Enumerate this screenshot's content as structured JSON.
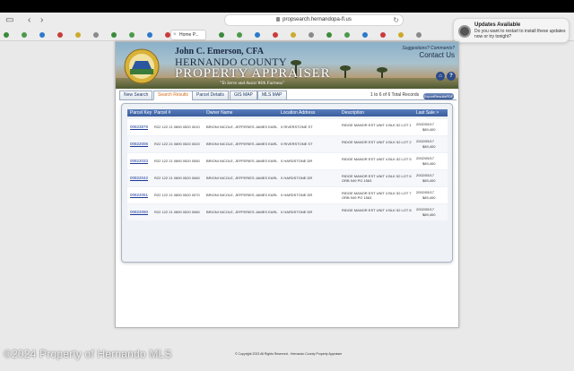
{
  "browser": {
    "url": "propsearch.hernandopa-fl.us",
    "active_tab": "Home P...",
    "favicon_colors": [
      "#3a8a3a",
      "#4a9a4a",
      "#2a7acc",
      "#cc3a3a",
      "#ccaa2a",
      "#8a8a8a"
    ]
  },
  "notification": {
    "title": "Updates Available",
    "body": "Do you want to restart to install these updates now or try tonight?"
  },
  "header": {
    "name": "John C. Emerson, CFA",
    "county": "HERNANDO COUNTY",
    "office": "PROPERTY APPRAISER",
    "motto": "\"To Serve and Assist With Fairness\"",
    "suggestions": "Suggestions? Comments?",
    "contact": "Contact Us"
  },
  "nav": {
    "tabs": [
      "New Search",
      "Search Results",
      "Parcel Details",
      "GIS MAP",
      "MLS MAP"
    ],
    "active_tab": "Search Results",
    "record_count": "1 to 6 of 6 Total Records",
    "export": "ExportResultsPDF"
  },
  "table": {
    "headers": [
      "Parcel Key",
      "Parcel #",
      "Owner Name",
      "Location Address",
      "Description",
      "Last Sale > $100"
    ],
    "rows": [
      {
        "key": "00823879",
        "parcel": "R22 122 21 0890 0520 0010",
        "owner": "BRIONI NICOLE, JEFFERIES JAMES EARL",
        "address": "0 RIVERSTONE ST",
        "description": "RIDGE MANOR EST UNIT 4 BLK 52 LOT 1",
        "sale_date": "2002/05/17",
        "sale_price": "$89,400"
      },
      {
        "key": "00822006",
        "parcel": "R22 122 21 0890 0520 0020",
        "owner": "BRIONI NICOLE, JEFFERIES JAMES EARL",
        "address": "0 RIVERSTONE ST",
        "description": "RIDGE MANOR EST UNIT 4 BLK 52 LOT 2",
        "sale_date": "2002/05/17",
        "sale_price": "$89,400"
      },
      {
        "key": "00822033",
        "parcel": "R22 122 21 0890 0520 0050",
        "owner": "BRIONI NICOLE, JEFFERIES JAMES EARL",
        "address": "0 HARDSTONE DR",
        "description": "RIDGE MANOR EST UNIT 4 BLK 52 LOT 5",
        "sale_date": "2002/05/17",
        "sale_price": "$89,400"
      },
      {
        "key": "00822042",
        "parcel": "R22 122 21 0890 0520 0060",
        "owner": "BRIONI NICOLE, JEFFERIES JAMES EARL",
        "address": "0 HARDSTONE DR",
        "description": "RIDGE MANOR EST UNIT 4 BLK 52 LOT 6 ORB 949 PG 1563",
        "sale_date": "2002/05/17",
        "sale_price": "$89,400"
      },
      {
        "key": "00822051",
        "parcel": "R22 122 21 0890 0520 0070",
        "owner": "BRIONI NICOLE, JEFFERIES JAMES EARL",
        "address": "0 HARDSTONE DR",
        "description": "RIDGE MANOR EST UNIT 4 BLK 52 LOT 7 ORB 949 PG 1563",
        "sale_date": "2002/05/17",
        "sale_price": "$89,400"
      },
      {
        "key": "00822060",
        "parcel": "R22 122 21 0890 0520 0080",
        "owner": "BRIONI NICOLE, JEFFERIES JAMES EARL",
        "address": "0 HARDSTONE DR",
        "description": "RIDGE MANOR EST UNIT 4 BLK 52 LOT 8",
        "sale_date": "2002/05/17",
        "sale_price": "$89,400"
      }
    ]
  },
  "footer": "© Copyright 2023 All Rights Reserved - Hernando County Property Appraiser",
  "watermark": "©2024 Property of Hernando MLS"
}
